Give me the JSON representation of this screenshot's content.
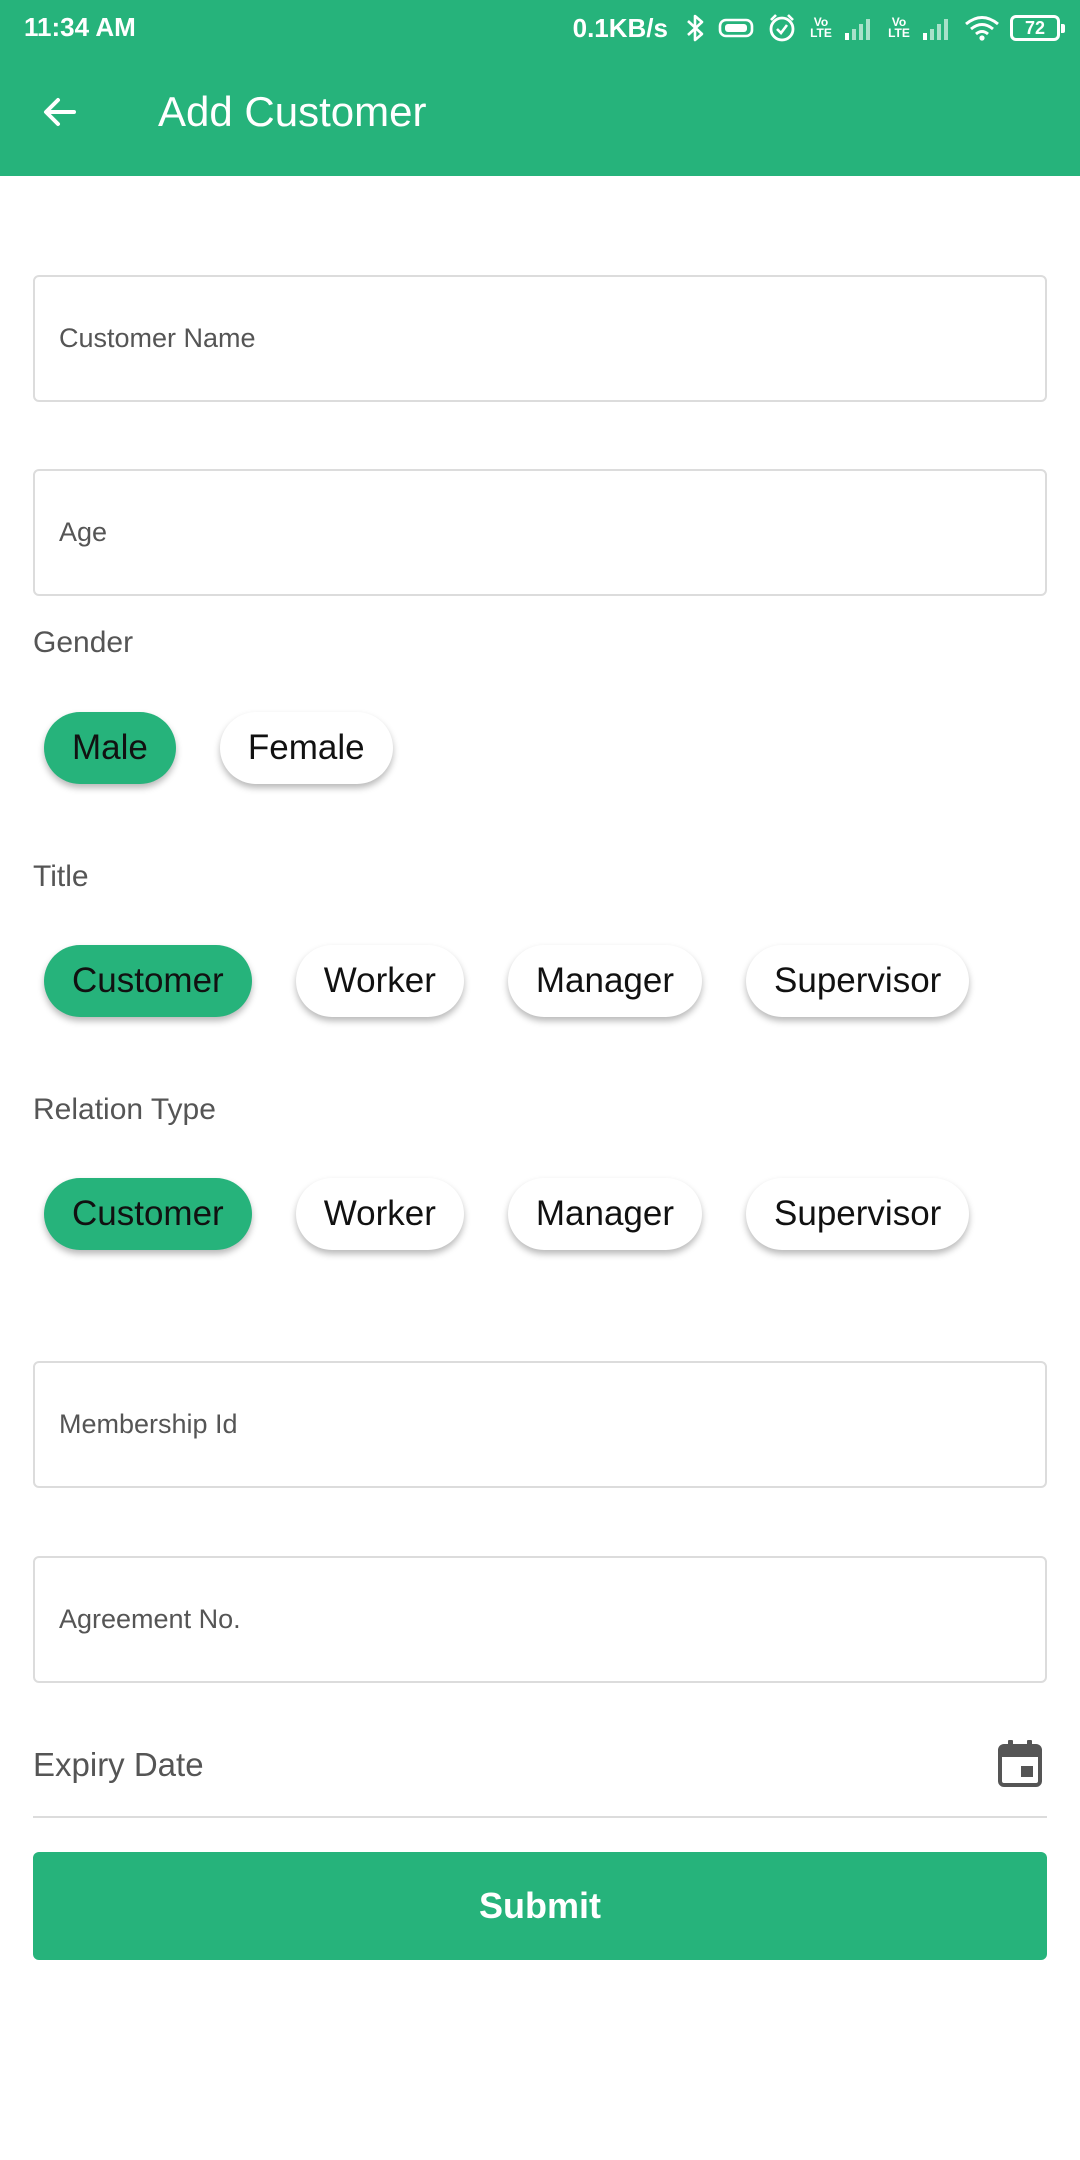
{
  "status_bar": {
    "time": "11:34 AM",
    "net_speed": "0.1KB/s",
    "volte_1": "Vo LTE",
    "volte_2": "Vo LTE",
    "battery": "72",
    "icons": [
      "bluetooth-icon",
      "vibrate-icon",
      "alarm-icon",
      "signal-icon",
      "wifi-icon",
      "battery-icon"
    ]
  },
  "toolbar": {
    "title": "Add Customer",
    "back_icon": "arrow-back-icon"
  },
  "form": {
    "customer_name": {
      "placeholder": "Customer Name",
      "value": ""
    },
    "age": {
      "placeholder": "Age",
      "value": ""
    },
    "gender": {
      "label": "Gender",
      "options": [
        "Male",
        "Female"
      ],
      "selected": "Male"
    },
    "title": {
      "label": "Title",
      "options": [
        "Customer",
        "Worker",
        "Manager",
        "Supervisor"
      ],
      "selected": "Customer"
    },
    "relation_type": {
      "label": "Relation Type",
      "options": [
        "Customer",
        "Worker",
        "Manager",
        "Supervisor"
      ],
      "selected": "Customer"
    },
    "membership_id": {
      "placeholder": "Membership Id",
      "value": ""
    },
    "agreement_no": {
      "placeholder": "Agreement No.",
      "value": ""
    },
    "expiry_date": {
      "label": "Expiry Date",
      "icon": "calendar-icon"
    },
    "submit_label": "Submit"
  },
  "colors": {
    "primary": "#26b37b",
    "chip_unselected": "#ffffff",
    "field_border": "#dcdcdc",
    "label_text": "#555555"
  }
}
